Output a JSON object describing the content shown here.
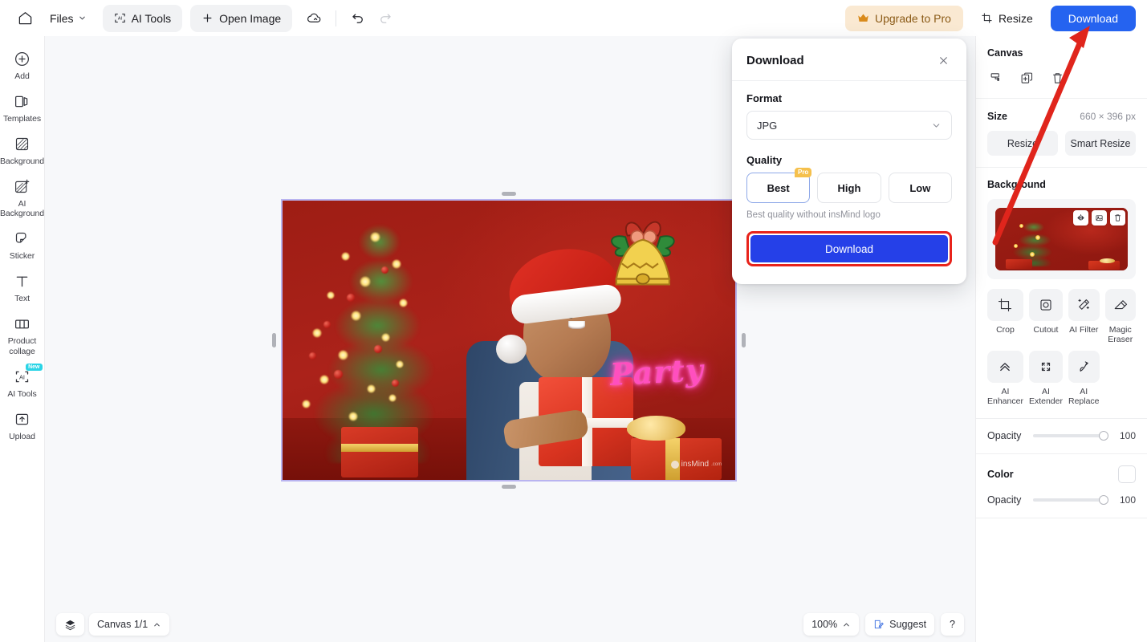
{
  "topbar": {
    "home_icon": "home-icon",
    "files_label": "Files",
    "ai_tools_label": "AI Tools",
    "open_image_label": "Open Image",
    "cloud_icon": "cloud-sync-icon",
    "undo_icon": "undo-icon",
    "redo_icon": "redo-icon",
    "upgrade_label": "Upgrade to Pro",
    "upgrade_icon": "crown-icon",
    "upgrade_bg": "#fae9d2",
    "upgrade_fg": "#8a5a16",
    "resize_label": "Resize",
    "resize_icon": "resize-icon",
    "download_label": "Download",
    "download_bg": "#2563f0"
  },
  "left_rail": {
    "items": [
      {
        "label": "Add",
        "icon": "plus-circle-icon",
        "badge": ""
      },
      {
        "label": "Templates",
        "icon": "templates-icon",
        "badge": ""
      },
      {
        "label": "Background",
        "icon": "background-icon",
        "badge": ""
      },
      {
        "label": "AI Background",
        "icon": "ai-background-icon",
        "badge": ""
      },
      {
        "label": "Sticker",
        "icon": "sticker-icon",
        "badge": ""
      },
      {
        "label": "Text",
        "icon": "text-icon",
        "badge": ""
      },
      {
        "label": "Product collage",
        "icon": "product-collage-icon",
        "badge": ""
      },
      {
        "label": "AI Tools",
        "icon": "ai-tools-icon",
        "badge": "New"
      },
      {
        "label": "Upload",
        "icon": "upload-icon",
        "badge": ""
      }
    ],
    "badge_color": "#2ad4e6"
  },
  "canvas": {
    "selection_border_color": "#b9b4f0",
    "artwork": {
      "neon_text": "Party",
      "neon_color": "#ff4fbf",
      "watermark": "insMind",
      "watermark_suffix": ".com",
      "background_color": "#a51f17"
    }
  },
  "dialog": {
    "title": "Download",
    "close_icon": "close-icon",
    "format_label": "Format",
    "format_value": "JPG",
    "format_chevron": "chevron-down-icon",
    "quality_label": "Quality",
    "quality_options": [
      {
        "label": "Best",
        "badge": "Pro",
        "selected": true
      },
      {
        "label": "High",
        "badge": "",
        "selected": false
      },
      {
        "label": "Low",
        "badge": "",
        "selected": false
      }
    ],
    "quality_hint": "Best quality without insMind logo",
    "cta_label": "Download",
    "cta_color": "#2540e8",
    "highlight_color": "#e8231b",
    "pro_badge_color": "#f5c04c"
  },
  "right_panel": {
    "canvas_title": "Canvas",
    "canvas_icons": [
      {
        "name": "paint-bucket-icon"
      },
      {
        "name": "duplicate-icon"
      },
      {
        "name": "delete-icon"
      }
    ],
    "size_label": "Size",
    "size_value": "660 × 396 px",
    "resize_label": "Resize",
    "smart_resize_label": "Smart Resize",
    "background_title": "Background",
    "thumb_icons": [
      {
        "name": "flip-icon"
      },
      {
        "name": "replace-image-icon"
      },
      {
        "name": "delete-icon"
      }
    ],
    "tools": [
      {
        "label": "Crop",
        "icon": "crop-icon"
      },
      {
        "label": "Cutout",
        "icon": "cutout-icon"
      },
      {
        "label": "AI Filter",
        "icon": "ai-filter-icon"
      },
      {
        "label": "Magic Eraser",
        "icon": "magic-eraser-icon"
      },
      {
        "label": "AI Enhancer",
        "icon": "ai-enhancer-icon"
      },
      {
        "label": "AI Extender",
        "icon": "ai-extender-icon"
      },
      {
        "label": "AI Replace",
        "icon": "ai-replace-icon"
      }
    ],
    "opacity_label": "Opacity",
    "opacity_value": "100",
    "color_label": "Color",
    "color_opacity_label": "Opacity",
    "color_opacity_value": "100",
    "color_swatch": "#ffffff"
  },
  "bottom_bar": {
    "layers_icon": "layers-icon",
    "canvas_label": "Canvas 1/1",
    "canvas_chevron": "chevron-up-icon",
    "zoom_label": "100%",
    "zoom_chevron": "chevron-up-icon",
    "suggest_label": "Suggest",
    "suggest_icon": "suggest-icon",
    "help_label": "?"
  },
  "annotation": {
    "arrow_color": "#e0251c",
    "description": "red-arrow-pointing-to-download-button"
  }
}
